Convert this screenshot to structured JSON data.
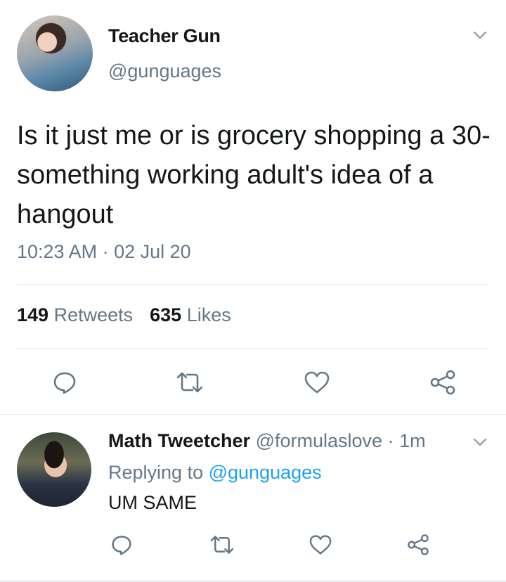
{
  "tweet": {
    "author_name": "Teacher Gun",
    "author_handle": "@gunguages",
    "text": "Is it just me or is grocery shopping a 30-something working adult's idea of a hangout",
    "timestamp": "10:23 AM · 02 Jul 20",
    "retweets_count": "149",
    "retweets_label": "Retweets",
    "likes_count": "635",
    "likes_label": "Likes",
    "actions": [
      {
        "icon": "reply-icon"
      },
      {
        "icon": "retweet-icon"
      },
      {
        "icon": "like-icon"
      },
      {
        "icon": "share-icon"
      }
    ]
  },
  "reply": {
    "author_name": "Math Tweetcher",
    "author_handle": "@formulaslove",
    "separator": "·",
    "time": "1m",
    "replying_prefix": "Replying to",
    "replying_handle": "@gunguages",
    "text": "UM SAME",
    "actions": [
      {
        "icon": "reply-icon"
      },
      {
        "icon": "retweet-icon"
      },
      {
        "icon": "like-icon"
      },
      {
        "icon": "share-icon"
      }
    ]
  },
  "colors": {
    "text": "#14171a",
    "secondary": "#657786",
    "link": "#1da1f2",
    "divider": "#e1e8ed"
  }
}
